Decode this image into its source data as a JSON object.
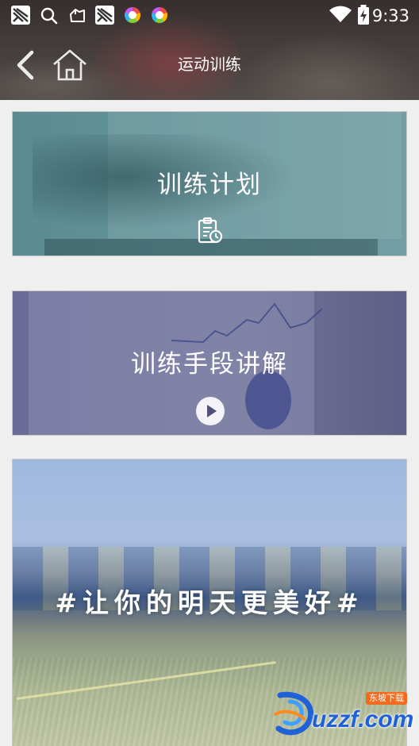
{
  "status_bar": {
    "time": "9:33",
    "left_icons": [
      "notification-app-icon",
      "search-icon",
      "bag-icon",
      "notification-app-icon",
      "color-app-icon",
      "color-app-icon"
    ],
    "right_icons": [
      "wifi-icon",
      "battery-charging-icon"
    ]
  },
  "title_bar": {
    "title": "运动训练",
    "back_icon": "chevron-left-icon",
    "home_icon": "home-icon"
  },
  "cards": [
    {
      "title": "训练计划",
      "icon": "clipboard-timer-icon",
      "tint": "#5f8e95"
    },
    {
      "title": "训练手段讲解",
      "icon": "play-icon",
      "tint": "#6b6c98"
    },
    {
      "title": "#让你的明天更美好#",
      "icon": "",
      "tint": "#9fb9de"
    }
  ],
  "watermark": {
    "text": "uzzf.com",
    "tag": "东坡下载",
    "color": "#1f62d8"
  }
}
